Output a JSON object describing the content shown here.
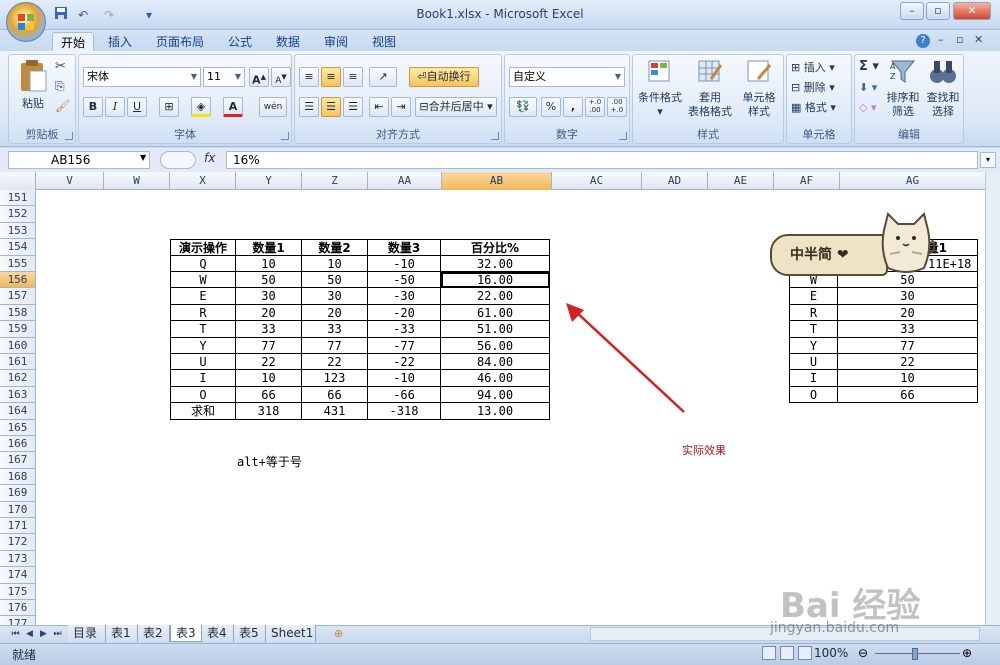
{
  "window": {
    "title": "Book1.xlsx - Microsoft Excel",
    "minimize": "–",
    "restore": "▫",
    "close": "✕"
  },
  "qat_icons": [
    "save-icon",
    "undo-icon",
    "redo-icon",
    "customize-icon"
  ],
  "ribbon_tabs": [
    "开始",
    "插入",
    "页面布局",
    "公式",
    "数据",
    "审阅",
    "视图"
  ],
  "active_tab": "开始",
  "ribbon": {
    "clipboard": {
      "label": "剪贴板",
      "paste": "粘贴"
    },
    "font": {
      "label": "字体",
      "font_name": "宋体",
      "font_size": "11",
      "grow": "A",
      "shrink": "A",
      "bold": "B",
      "italic": "I",
      "underline": "U",
      "font_color_letter": "A",
      "phonetic": "wén"
    },
    "alignment": {
      "label": "对齐方式",
      "wrap_text": "自动换行",
      "merge_center": "合并后居中"
    },
    "number": {
      "label": "数字",
      "format": "自定义",
      "percent": "%",
      "comma": ",",
      "inc_decimal": "+.0\n.00",
      "dec_decimal": ".00\n+.0"
    },
    "styles": {
      "label": "样式",
      "conditional": "条件格式",
      "table_format_1": "套用",
      "table_format_2": "表格格式",
      "cell_style_1": "单元格",
      "cell_style_2": "样式"
    },
    "cells": {
      "label": "单元格",
      "insert": "插入",
      "delete": "删除",
      "format": "格式"
    },
    "editing": {
      "label": "编辑",
      "sort_1": "排序和",
      "sort_2": "筛选",
      "find_1": "查找和",
      "find_2": "选择",
      "sum": "Σ"
    }
  },
  "formula_bar": {
    "name_box": "AB156",
    "fx": "fx",
    "content": "16%"
  },
  "columns": [
    {
      "name": "V",
      "w": 68
    },
    {
      "name": "W",
      "w": 66
    },
    {
      "name": "X",
      "w": 66
    },
    {
      "name": "Y",
      "w": 66
    },
    {
      "name": "Z",
      "w": 66
    },
    {
      "name": "AA",
      "w": 74
    },
    {
      "name": "AB",
      "w": 110
    },
    {
      "name": "AC",
      "w": 90
    },
    {
      "name": "AD",
      "w": 66
    },
    {
      "name": "AE",
      "w": 66
    },
    {
      "name": "AF",
      "w": 66
    },
    {
      "name": "AG",
      "w": 146
    }
  ],
  "selected_column": "AB",
  "rows": [
    "151",
    "152",
    "153",
    "154",
    "155",
    "156",
    "157",
    "158",
    "159",
    "160",
    "161",
    "162",
    "163",
    "164",
    "165",
    "166",
    "167",
    "168",
    "169",
    "170",
    "171",
    "172",
    "173",
    "174",
    "175",
    "176",
    "177"
  ],
  "selected_row": "156",
  "table": {
    "headers": [
      "演示操作",
      "数量1",
      "数量2",
      "数量3",
      "百分比%"
    ],
    "rows": [
      [
        "Q",
        "10",
        "10",
        "-10",
        "32.00"
      ],
      [
        "W",
        "50",
        "50",
        "-50",
        "16.00"
      ],
      [
        "E",
        "30",
        "30",
        "-30",
        "22.00"
      ],
      [
        "R",
        "20",
        "20",
        "-20",
        "61.00"
      ],
      [
        "T",
        "33",
        "33",
        "-33",
        "51.00"
      ],
      [
        "Y",
        "77",
        "77",
        "-77",
        "56.00"
      ],
      [
        "U",
        "22",
        "22",
        "-22",
        "84.00"
      ],
      [
        "I",
        "10",
        "123",
        "-10",
        "46.00"
      ],
      [
        "O",
        "66",
        "66",
        "-66",
        "94.00"
      ],
      [
        "求和",
        "318",
        "431",
        "-318",
        "13.00"
      ]
    ]
  },
  "right_table": {
    "header_partial": "量1",
    "first_value": "11E+18",
    "rows": [
      [
        "W",
        "50"
      ],
      [
        "E",
        "30"
      ],
      [
        "R",
        "20"
      ],
      [
        "T",
        "33"
      ],
      [
        "Y",
        "77"
      ],
      [
        "U",
        "22"
      ],
      [
        "I",
        "10"
      ],
      [
        "O",
        "66"
      ]
    ]
  },
  "notes": {
    "shortcut": "alt+等于号",
    "effect": "实际效果"
  },
  "sticker": {
    "text": "中半简 ❤"
  },
  "sheet_tabs": [
    "目录",
    "表1",
    "表2",
    "表3",
    "表4",
    "表5",
    "Sheet1"
  ],
  "active_sheet": "表3",
  "status": {
    "ready": "就绪",
    "zoom": "100%"
  },
  "watermark": {
    "logo": "Bai 经验",
    "url": "jingyan.baidu.com"
  },
  "colors": {
    "arrow": "#d42020",
    "note": "#a01818",
    "selection_header": "#f1b85a"
  }
}
